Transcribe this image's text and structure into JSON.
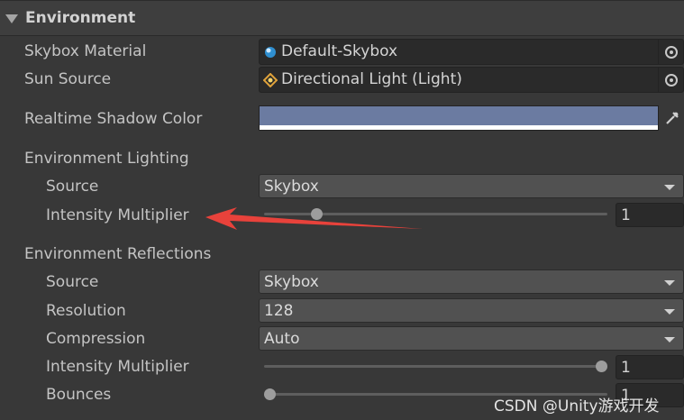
{
  "section": {
    "title": "Environment",
    "icon": "foldout-arrow-down-icon"
  },
  "skybox_material": {
    "label": "Skybox Material",
    "value": "Default-Skybox",
    "icon": "material-sphere-icon"
  },
  "sun_source": {
    "label": "Sun Source",
    "value": "Directional Light (Light)",
    "icon": "light-icon"
  },
  "realtime_shadow_color": {
    "label": "Realtime Shadow Color",
    "color": "#6b7ba1",
    "icon": "eyedropper-icon"
  },
  "environment_lighting": {
    "label": "Environment Lighting",
    "source": {
      "label": "Source",
      "value": "Skybox"
    },
    "intensity_multiplier": {
      "label": "Intensity Multiplier",
      "value": "1",
      "slider_fraction": 0.14
    }
  },
  "environment_reflections": {
    "label": "Environment Reflections",
    "source": {
      "label": "Source",
      "value": "Skybox"
    },
    "resolution": {
      "label": "Resolution",
      "value": "128"
    },
    "compression": {
      "label": "Compression",
      "value": "Auto"
    },
    "intensity_multiplier": {
      "label": "Intensity Multiplier",
      "value": "1",
      "slider_fraction": 1.0
    },
    "bounces": {
      "label": "Bounces",
      "value": "1",
      "slider_fraction": 0.0
    }
  },
  "annotation": {
    "arrow_color": "#e8423b"
  },
  "watermark": "CSDN @Unity游戏开发"
}
